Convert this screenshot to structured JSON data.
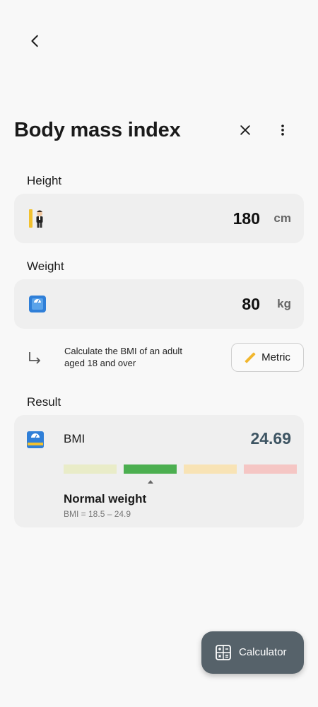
{
  "header": {
    "title": "Body mass index"
  },
  "icons": {
    "back": "chevron-left-icon",
    "close": "close-icon",
    "more": "more-vertical-icon",
    "height": "height-person-icon",
    "weight": "scale-icon",
    "hint": "arrow-turn-icon",
    "metric": "ruler-icon",
    "result": "scale-icon",
    "calculator": "calculator-icon"
  },
  "height": {
    "label": "Height",
    "value": "180",
    "unit": "cm"
  },
  "weight": {
    "label": "Weight",
    "value": "80",
    "unit": "kg"
  },
  "hint": {
    "line1": "Calculate the BMI of an adult",
    "line2": "aged 18 and over",
    "unit_system_label": "Metric"
  },
  "result": {
    "label": "Result",
    "bmi_label": "BMI",
    "bmi_value": "24.69",
    "category": "Normal weight",
    "range": "BMI = 18.5 – 24.9",
    "active_segment": 1,
    "segment_colors": [
      "#e9ecc8",
      "#4caf50",
      "#f8e3b5",
      "#f5c6c4"
    ]
  },
  "fab": {
    "label": "Calculator"
  },
  "colors": {
    "background": "#f8f8f8",
    "card": "#efefef",
    "bmi_value": "#3e5563",
    "fab": "#56626a"
  }
}
